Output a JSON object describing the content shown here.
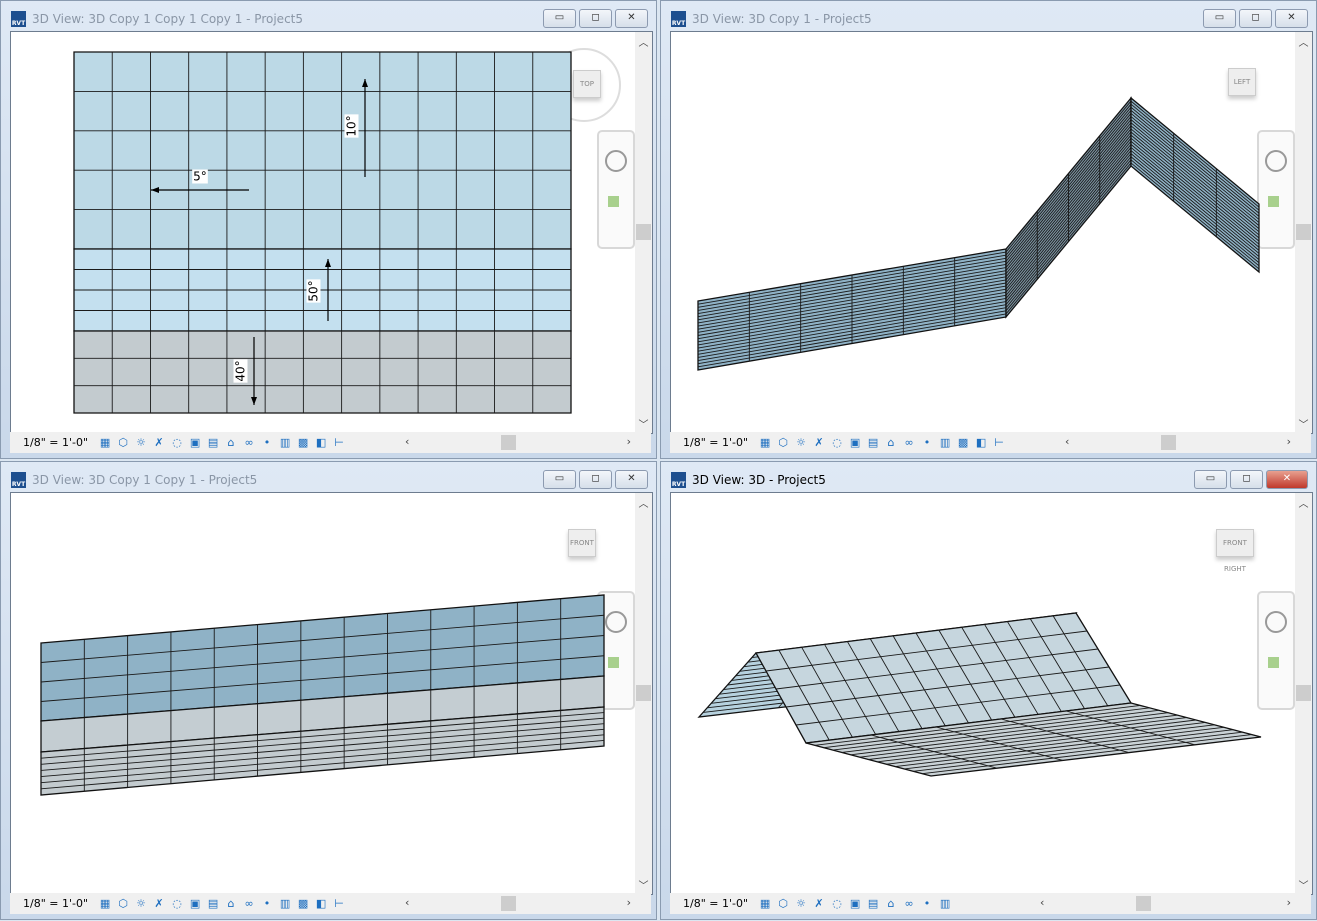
{
  "windows": [
    {
      "title": "3D View: 3D Copy 1 Copy 1 Copy 1 - Project5",
      "active": false,
      "view_cube": "TOP",
      "scale": "1/8\" = 1'-0\"",
      "annotations": [
        "10°",
        "5°",
        "50°",
        "40°"
      ]
    },
    {
      "title": "3D View: 3D Copy 1 - Project5",
      "active": false,
      "view_cube": "LEFT",
      "scale": "1/8\" = 1'-0\"",
      "annotations": []
    },
    {
      "title": "3D View: 3D Copy 1 Copy 1 - Project5",
      "active": false,
      "view_cube": "FRONT",
      "scale": "1/8\" = 1'-0\"",
      "annotations": []
    },
    {
      "title": "3D View: 3D - Project5",
      "active": true,
      "view_cube": "FRONT RIGHT",
      "scale": "1/8\" = 1'-0\"",
      "annotations": []
    }
  ],
  "window_controls": {
    "minimize": "▭",
    "restore": "◻",
    "close": "✕"
  },
  "status_icons": [
    "detail-level-icon",
    "visual-style-icon",
    "sun-path-icon",
    "shadows-icon",
    "show-rendering-icon",
    "crop-view-icon",
    "show-crop-icon",
    "unlock-3d-view-icon",
    "temp-hide-icon",
    "reveal-hidden-icon",
    "temp-view-properties-icon",
    "show-analytical-icon",
    "highlight-displacement-icon",
    "constraints-icon"
  ],
  "colors": {
    "glass": "#bcd9e6",
    "glass_dark": "#8fb2c6",
    "wall_gray": "#c3cbcf",
    "active_close": "#c0392b"
  }
}
